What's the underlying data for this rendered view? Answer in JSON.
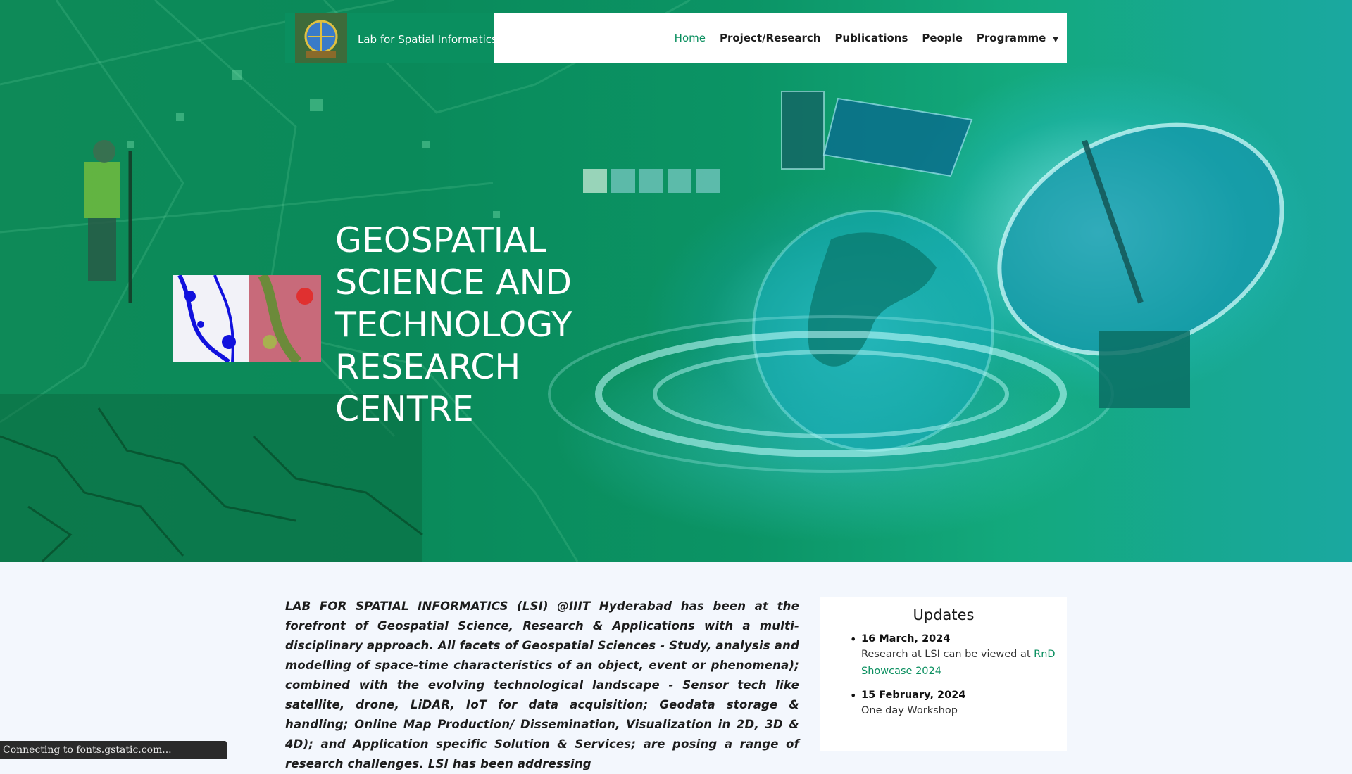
{
  "header": {
    "brand_name": "Lab for Spatial Informatics",
    "nav": [
      {
        "label": "Home",
        "active": true
      },
      {
        "label": "Project/Research"
      },
      {
        "label": "Publications"
      },
      {
        "label": "People"
      },
      {
        "label": "Programme",
        "has_dropdown": true
      }
    ]
  },
  "hero": {
    "title_lines": [
      "GEOSPATIAL",
      "SCIENCE AND",
      "TECHNOLOGY",
      "RESEARCH",
      "CENTRE"
    ],
    "slides_count": 5,
    "active_slide": 1
  },
  "intro": {
    "text": "LAB FOR SPATIAL INFORMATICS (LSI) @IIIT Hyderabad has been at the forefront of Geospatial Science, Research & Applications with a multi-disciplinary approach. All facets of Geospatial Sciences - Study, analysis and modelling of space-time characteristics of an object, event or phenomena); combined with the evolving technological landscape - Sensor tech like satellite, drone, LiDAR, IoT for data acquisition; Geodata storage & handling; Online Map Production/ Dissemination, Visualization in 2D, 3D & 4D); and Application specific Solution & Services; are posing a range of research challenges. LSI has been addressing"
  },
  "updates": {
    "title": "Updates",
    "items": [
      {
        "date": "16 March, 2024",
        "text": "Research at LSI can be viewed at ",
        "link": "RnD Showcase 2024"
      },
      {
        "date": "15 February, 2024",
        "text": "One day Workshop",
        "link": ""
      }
    ]
  },
  "status_bar": {
    "text": "Connecting to fonts.gstatic.com..."
  },
  "colors": {
    "brand_green": "#0a8f5f",
    "hero_green": "#0e8a58",
    "page_bg": "#f3f7fd"
  }
}
